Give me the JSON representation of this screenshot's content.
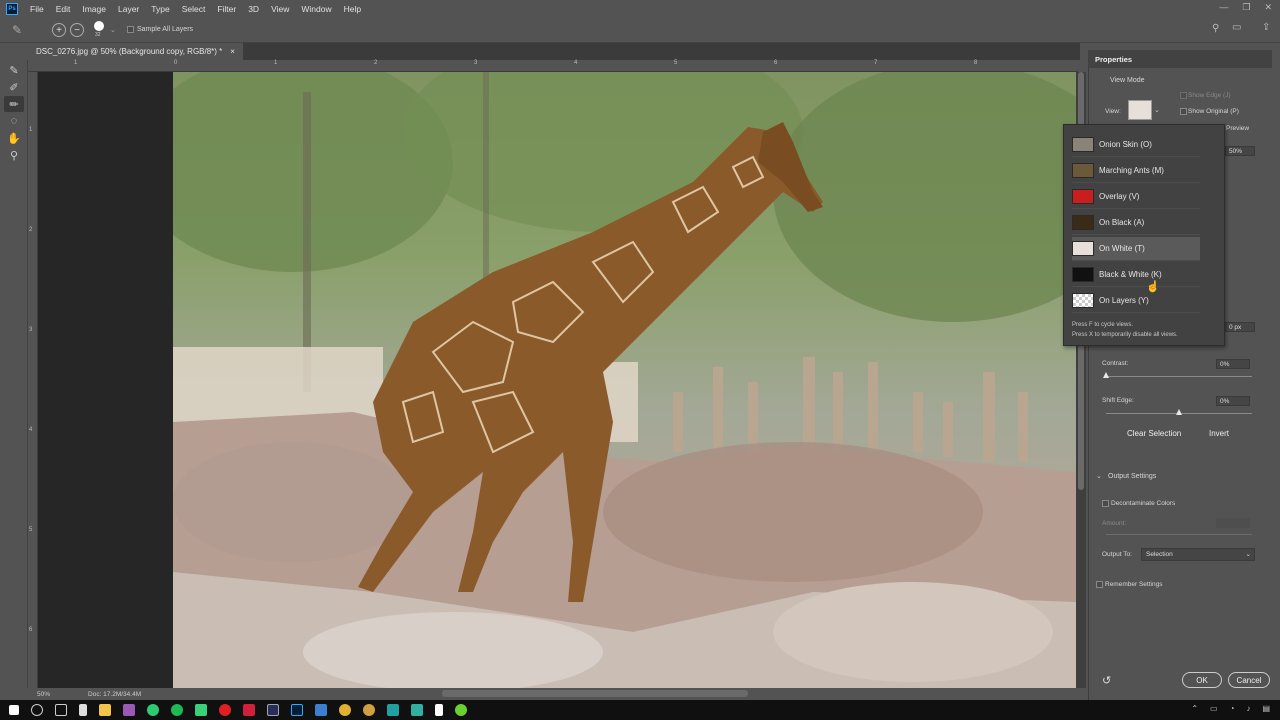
{
  "app": {
    "logo": "Ps",
    "menu": [
      "File",
      "Edit",
      "Image",
      "Layer",
      "Type",
      "Select",
      "Filter",
      "3D",
      "View",
      "Window",
      "Help"
    ]
  },
  "options_bar": {
    "brush_size": "32",
    "sample_all_layers_label": "Sample All Layers"
  },
  "document": {
    "tab_title": "DSC_0276.jpg @ 50% (Background copy, RGB/8*) *",
    "close_glyph": "×"
  },
  "rulers": {
    "top_ticks": [
      "1",
      "0",
      "1",
      "2",
      "3",
      "4",
      "5",
      "6",
      "7",
      "8"
    ],
    "left_ticks": [
      "1",
      "2",
      "3",
      "4",
      "5",
      "6"
    ]
  },
  "status": {
    "zoom": "50%",
    "doc_size": "Doc: 17.2M/34.4M"
  },
  "properties": {
    "title": "Properties",
    "view_mode_label": "View Mode",
    "view_label": "View:",
    "show_edge_label": "Show Edge (J)",
    "show_original_label": "Show Original (P)",
    "preview_label": "Preview",
    "opacity_value": "50%",
    "radius_value": "0 px",
    "contrast_label": "Contrast:",
    "contrast_value": "0%",
    "contrast_level": 0,
    "shift_edge_label": "Shift Edge:",
    "shift_edge_value": "0%",
    "shift_edge_level": 0.5,
    "clear_selection_label": "Clear Selection",
    "invert_label": "Invert",
    "output_settings_label": "Output Settings",
    "decontaminate_label": "Decontaminate Colors",
    "amount_label": "Amount:",
    "output_to_label": "Output To:",
    "output_to_value": "Selection",
    "remember_label": "Remember Settings",
    "ok_label": "OK",
    "cancel_label": "Cancel"
  },
  "view_menu": {
    "items": [
      {
        "label": "Onion Skin (O)",
        "thumb": "#8a8478"
      },
      {
        "label": "Marching Ants (M)",
        "thumb": "#6b5a3a"
      },
      {
        "label": "Overlay (V)",
        "thumb": "#c81e1e"
      },
      {
        "label": "On Black (A)",
        "thumb": "#3a2a18"
      },
      {
        "label": "On White (T)",
        "thumb": "#e8e0d8"
      },
      {
        "label": "Black & White (K)",
        "thumb": "#111111"
      },
      {
        "label": "On Layers (Y)",
        "thumb": "#dddddd"
      }
    ],
    "hint1": "Press F to cycle views.",
    "hint2": "Press X to temporarily disable all views."
  },
  "colors": {
    "panel": "#535353",
    "dark": "#424242",
    "canvas_bg": "#262626",
    "taskbar": "#101010"
  }
}
